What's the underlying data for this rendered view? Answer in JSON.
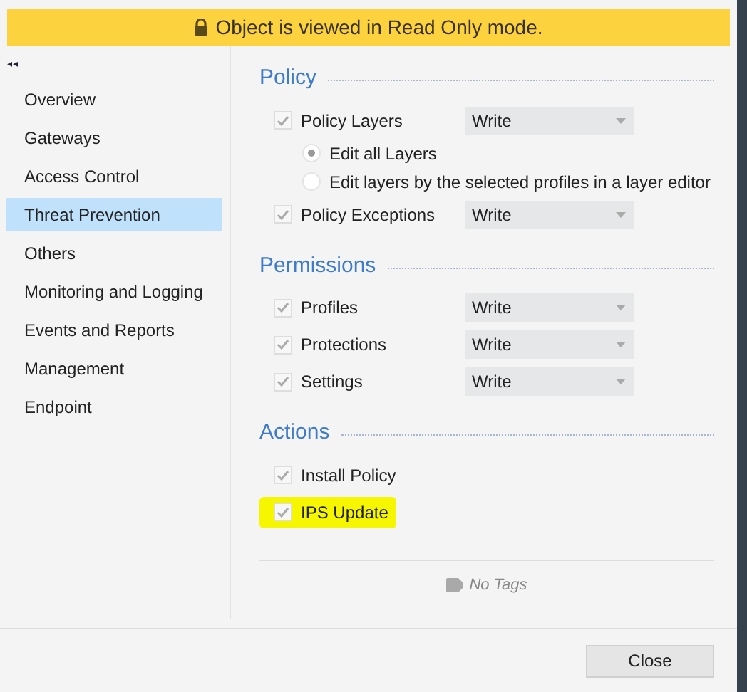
{
  "banner": {
    "text": "Object is viewed in Read Only mode."
  },
  "sidebar": {
    "collapse": "◂◂",
    "items": [
      {
        "label": "Overview",
        "selected": false
      },
      {
        "label": "Gateways",
        "selected": false
      },
      {
        "label": "Access Control",
        "selected": false
      },
      {
        "label": "Threat Prevention",
        "selected": true
      },
      {
        "label": "Others",
        "selected": false
      },
      {
        "label": "Monitoring and Logging",
        "selected": false
      },
      {
        "label": "Events and Reports",
        "selected": false
      },
      {
        "label": "Management",
        "selected": false
      },
      {
        "label": "Endpoint",
        "selected": false
      }
    ]
  },
  "sections": [
    {
      "title": "Policy",
      "rows": [
        {
          "kind": "checkbox",
          "label": "Policy Layers",
          "checked": true,
          "value": "Write"
        },
        {
          "kind": "radio",
          "label": "Edit all Layers",
          "selected": true
        },
        {
          "kind": "radio",
          "label": "Edit layers by the selected profiles in a layer editor",
          "selected": false
        },
        {
          "kind": "checkbox",
          "label": "Policy Exceptions",
          "checked": true,
          "value": "Write"
        }
      ]
    },
    {
      "title": "Permissions",
      "rows": [
        {
          "kind": "checkbox",
          "label": "Profiles",
          "checked": true,
          "value": "Write"
        },
        {
          "kind": "checkbox",
          "label": "Protections",
          "checked": true,
          "value": "Write"
        },
        {
          "kind": "checkbox",
          "label": "Settings",
          "checked": true,
          "value": "Write"
        }
      ]
    },
    {
      "title": "Actions",
      "rows": [
        {
          "kind": "checkbox",
          "label": "Install Policy",
          "checked": true,
          "highlighted": false
        },
        {
          "kind": "checkbox",
          "label": "IPS Update",
          "checked": true,
          "highlighted": true
        }
      ]
    }
  ],
  "tags": {
    "text": "No Tags"
  },
  "buttons": [
    "Close"
  ]
}
